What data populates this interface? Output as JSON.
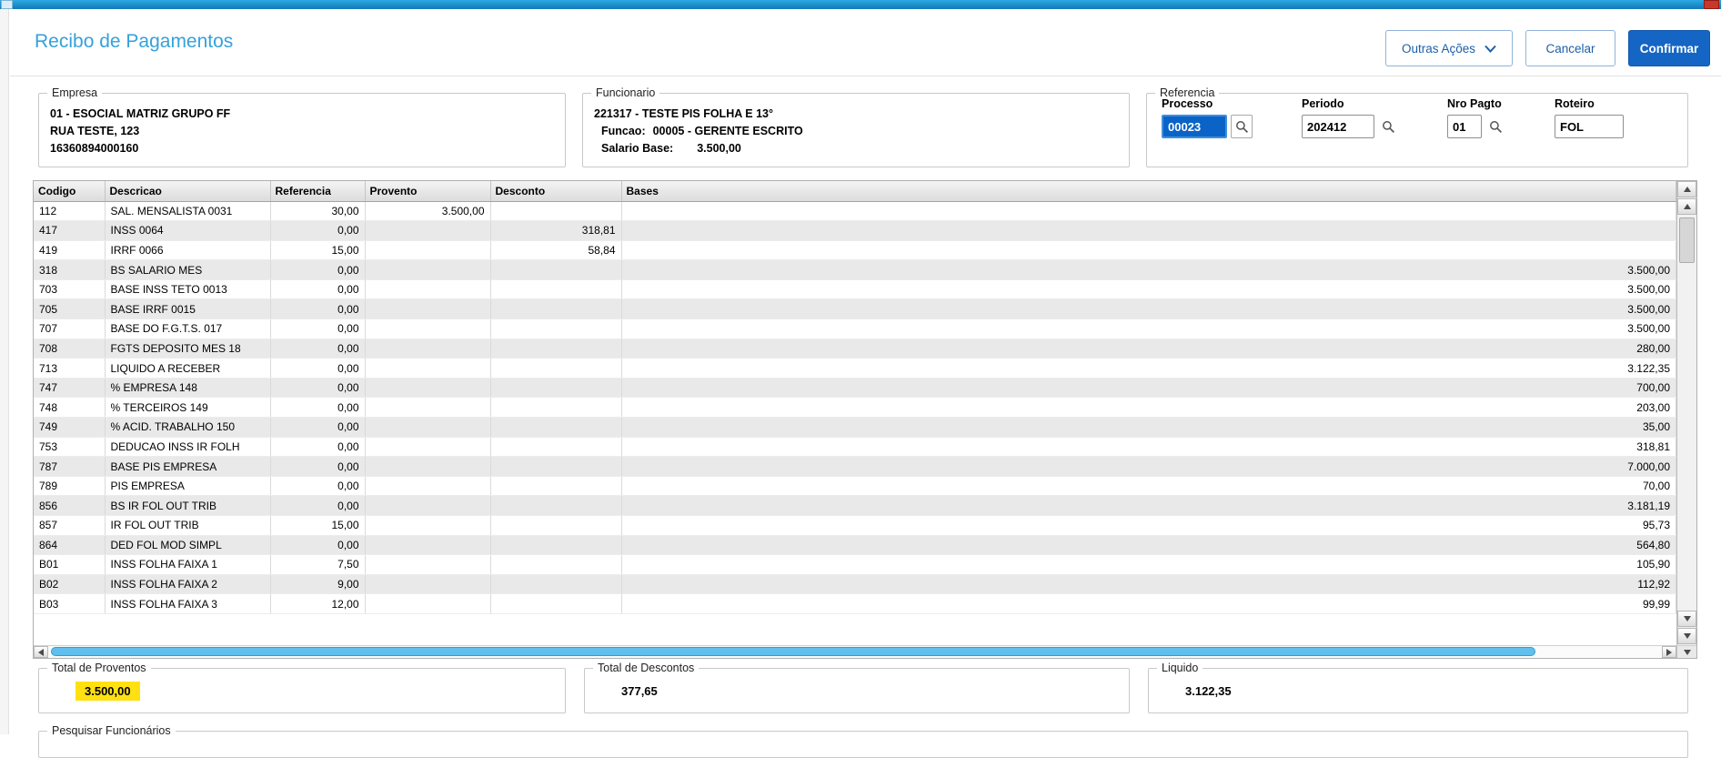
{
  "header": {
    "title": "Recibo de Pagamentos",
    "buttons": {
      "outras_acoes": "Outras Ações",
      "cancelar": "Cancelar",
      "confirmar": "Confirmar"
    }
  },
  "empresa": {
    "legend": "Empresa",
    "lines": [
      "01 - ESOCIAL MATRIZ GRUPO FF",
      "RUA TESTE, 123",
      "16360894000160"
    ]
  },
  "funcionario": {
    "legend": "Funcionario",
    "line1": "221317 - TESTE PIS FOLHA E 13°",
    "funcao_label": "Funcao:",
    "funcao_value": "00005 - GERENTE ESCRITO",
    "salario_label": "Salario Base:",
    "salario_value": "3.500,00"
  },
  "referencia": {
    "legend": "Referencia",
    "fields": [
      {
        "label": "Processo",
        "value": "00023",
        "lookup": true,
        "selected": true
      },
      {
        "label": "Periodo",
        "value": "202412",
        "lookup": true,
        "selected": false
      },
      {
        "label": "Nro Pagto",
        "value": "01",
        "lookup": true,
        "selected": false
      },
      {
        "label": "Roteiro",
        "value": "FOL",
        "lookup": false,
        "selected": false
      }
    ]
  },
  "grid": {
    "columns": [
      "Codigo",
      "Descricao",
      "Referencia",
      "Provento",
      "Desconto",
      "Bases"
    ],
    "rows": [
      {
        "codigo": "112",
        "descricao": "SAL. MENSALISTA 0031",
        "referencia": "30,00",
        "provento": "3.500,00",
        "desconto": "",
        "bases": ""
      },
      {
        "codigo": "417",
        "descricao": "INSS 0064",
        "referencia": "0,00",
        "provento": "",
        "desconto": "318,81",
        "bases": ""
      },
      {
        "codigo": "419",
        "descricao": "IRRF 0066",
        "referencia": "15,00",
        "provento": "",
        "desconto": "58,84",
        "bases": ""
      },
      {
        "codigo": "318",
        "descricao": "BS SALARIO MES",
        "referencia": "0,00",
        "provento": "",
        "desconto": "",
        "bases": "3.500,00"
      },
      {
        "codigo": "703",
        "descricao": "BASE INSS TETO 0013",
        "referencia": "0,00",
        "provento": "",
        "desconto": "",
        "bases": "3.500,00"
      },
      {
        "codigo": "705",
        "descricao": "BASE IRRF 0015",
        "referencia": "0,00",
        "provento": "",
        "desconto": "",
        "bases": "3.500,00"
      },
      {
        "codigo": "707",
        "descricao": "BASE DO F.G.T.S. 017",
        "referencia": "0,00",
        "provento": "",
        "desconto": "",
        "bases": "3.500,00"
      },
      {
        "codigo": "708",
        "descricao": "FGTS DEPOSITO MES 18",
        "referencia": "0,00",
        "provento": "",
        "desconto": "",
        "bases": "280,00"
      },
      {
        "codigo": "713",
        "descricao": "LIQUIDO A RECEBER",
        "referencia": "0,00",
        "provento": "",
        "desconto": "",
        "bases": "3.122,35"
      },
      {
        "codigo": "747",
        "descricao": "% EMPRESA 148",
        "referencia": "0,00",
        "provento": "",
        "desconto": "",
        "bases": "700,00"
      },
      {
        "codigo": "748",
        "descricao": "% TERCEIROS 149",
        "referencia": "0,00",
        "provento": "",
        "desconto": "",
        "bases": "203,00"
      },
      {
        "codigo": "749",
        "descricao": "% ACID. TRABALHO 150",
        "referencia": "0,00",
        "provento": "",
        "desconto": "",
        "bases": "35,00"
      },
      {
        "codigo": "753",
        "descricao": "DEDUCAO INSS IR FOLH",
        "referencia": "0,00",
        "provento": "",
        "desconto": "",
        "bases": "318,81"
      },
      {
        "codigo": "787",
        "descricao": "BASE PIS EMPRESA",
        "referencia": "0,00",
        "provento": "",
        "desconto": "",
        "bases": "7.000,00"
      },
      {
        "codigo": "789",
        "descricao": "PIS EMPRESA",
        "referencia": "0,00",
        "provento": "",
        "desconto": "",
        "bases": "70,00"
      },
      {
        "codigo": "856",
        "descricao": "BS IR FOL OUT TRIB",
        "referencia": "0,00",
        "provento": "",
        "desconto": "",
        "bases": "3.181,19"
      },
      {
        "codigo": "857",
        "descricao": "IR FOL OUT TRIB",
        "referencia": "15,00",
        "provento": "",
        "desconto": "",
        "bases": "95,73"
      },
      {
        "codigo": "864",
        "descricao": "DED FOL MOD SIMPL",
        "referencia": "0,00",
        "provento": "",
        "desconto": "",
        "bases": "564,80"
      },
      {
        "codigo": "B01",
        "descricao": "INSS FOLHA FAIXA 1",
        "referencia": "7,50",
        "provento": "",
        "desconto": "",
        "bases": "105,90"
      },
      {
        "codigo": "B02",
        "descricao": "INSS FOLHA FAIXA 2",
        "referencia": "9,00",
        "provento": "",
        "desconto": "",
        "bases": "112,92"
      },
      {
        "codigo": "B03",
        "descricao": "INSS FOLHA FAIXA 3",
        "referencia": "12,00",
        "provento": "",
        "desconto": "",
        "bases": "99,99"
      }
    ]
  },
  "totals": {
    "proventos": {
      "legend": "Total de Proventos",
      "value": "3.500,00"
    },
    "descontos": {
      "legend": "Total de Descontos",
      "value": "377,65"
    },
    "liquido": {
      "legend": "Liquido",
      "value": "3.122,35"
    }
  },
  "pesquisar": {
    "legend": "Pesquisar Funcionários"
  },
  "colors": {
    "accent_blue": "#35a1da",
    "confirm_button_blue": "#1565c4",
    "highlight_yellow": "#ffe011",
    "selection_blue": "#0a64c8",
    "hscroll_thumb_blue": "#5fc0ee"
  }
}
